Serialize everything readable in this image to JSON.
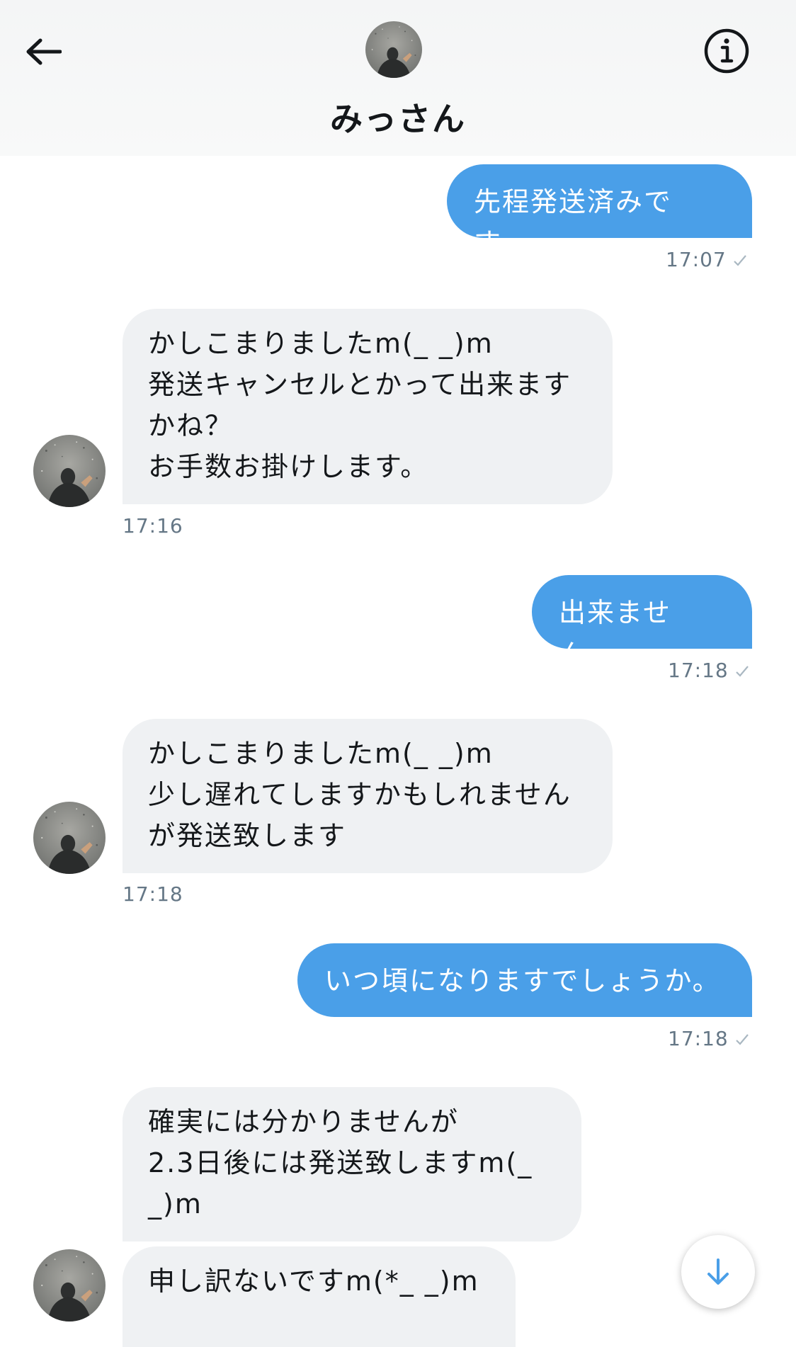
{
  "header": {
    "title": "みっさん",
    "back_icon": "arrow-left-icon",
    "info_icon": "info-circle-icon"
  },
  "messages": [
    {
      "direction": "sent",
      "text": "先程発送済みです。",
      "time": "17:07"
    },
    {
      "direction": "received",
      "text": "かしこまりましたm(_ _)m\n発送キャンセルとかって出来ます\nかね？\nお手数お掛けします。",
      "time": "17:16"
    },
    {
      "direction": "sent",
      "text": "出来ません。",
      "time": "17:18"
    },
    {
      "direction": "received",
      "text": "かしこまりましたm(_ _)m\n少し遅れてしますかもしれません\nが発送致します",
      "time": "17:18"
    },
    {
      "direction": "sent",
      "text": "いつ頃になりますでしょうか。",
      "time": "17:18"
    },
    {
      "direction": "received",
      "text": "確実には分かりませんが\n2.3日後には発送致しますm(_\n_)m"
    },
    {
      "direction": "received",
      "text": "申し訳ないですm(*_ _)m"
    }
  ],
  "scroll_down_icon": "arrow-down-icon",
  "colors": {
    "sent_bubble": "#4a9fe8",
    "received_bubble": "#eff1f3",
    "timestamp": "#657786"
  }
}
